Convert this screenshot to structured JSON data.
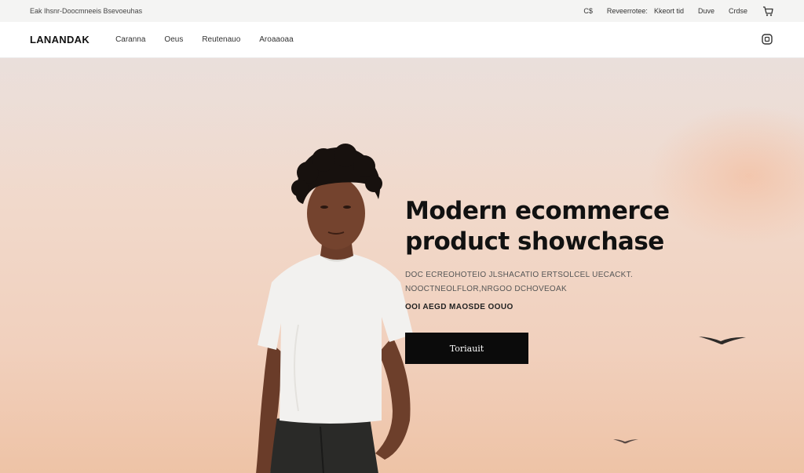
{
  "topbar": {
    "promo": "Eak Ihsnr-Doocmneeis Bsevoeuhas",
    "currency": "C$",
    "links": [
      "Reveerrotee:",
      "Kkeort tid",
      "Duve",
      "Crdse"
    ],
    "cart_icon": "cart-icon"
  },
  "navbar": {
    "logo": "LANANDAK",
    "links": [
      "Caranna",
      "Oeus",
      "Reutenauo",
      "Aroaaoaa"
    ],
    "account_icon": "account-icon"
  },
  "hero": {
    "title_line1": "Modern ecommerce",
    "title_line2": "product showchase",
    "subtitle_line1": "DOC ECREOHOTEIO JLSHACATIO ERTSOLCEL UECACKT.",
    "subtitle_line2": "NOOCTNEOLFLOR,NRGOO DCHOVEOAK",
    "tagline": "OOI AEGD MAOSDE OOUO",
    "cta_label": "Toriauit"
  },
  "colors": {
    "accent": "#0b0b0b",
    "hero_bg": "#f1d9cb",
    "topbar_bg": "#f4f4f3"
  }
}
